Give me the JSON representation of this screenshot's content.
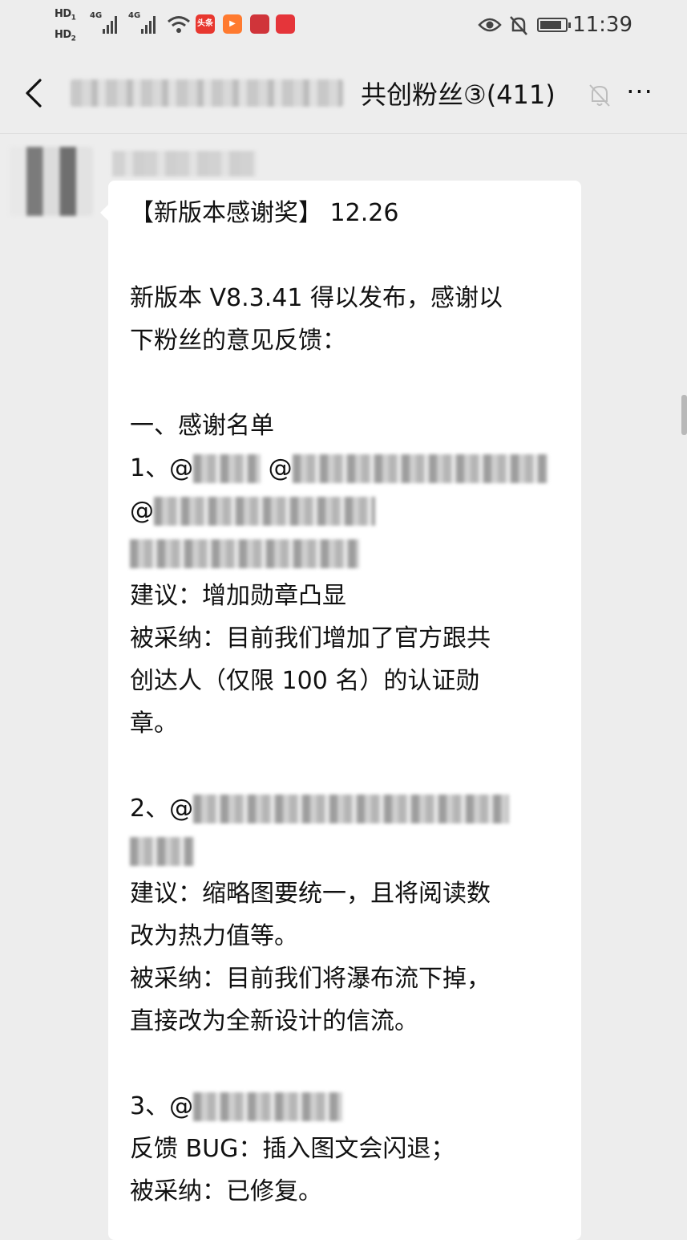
{
  "status_bar": {
    "sim1": "HD",
    "sim1_sub": "1",
    "sim2": "HD",
    "sim2_sub": "2",
    "network1": "4G",
    "network2": "4G",
    "app_icons": [
      {
        "name": "toutiao-icon",
        "label": "头条",
        "color": "#e8372f"
      },
      {
        "name": "video-app-icon",
        "label": "▶",
        "color": "#ff7a2f"
      },
      {
        "name": "app-icon-3",
        "label": "",
        "color": "#d0343a"
      },
      {
        "name": "huawei-icon",
        "label": "",
        "color": "#e5353a"
      }
    ],
    "battery_level": 0.85,
    "time": "11:39"
  },
  "header": {
    "back_icon": "chevron-left-icon",
    "title": "共创粉丝③(411)",
    "mute_icon": "bell-muted-icon",
    "more_label": "···"
  },
  "message": {
    "lines": [
      "【新版本感谢奖】 12.26",
      "",
      "新版本 V8.3.41 得以发布，感谢以",
      "下粉丝的意见反馈：",
      "",
      "一、感谢名单",
      "1、@",
      "@",
      "",
      "建议：增加勋章凸显",
      "被采纳：目前我们增加了官方跟共",
      "创达人（仅限 100 名）的认证勋",
      "章。",
      "",
      "2、@",
      "",
      "建议：缩略图要统一，且将阅读数",
      "改为热力值等。",
      "被采纳：目前我们将瀑布流下掉，",
      "直接改为全新设计的信流。",
      "",
      "3、@",
      "反馈 BUG：插入图文会闪退；",
      "被采纳：已修复。"
    ]
  },
  "colors": {
    "background": "#ededed",
    "bubble": "#ffffff",
    "text": "#111111"
  }
}
